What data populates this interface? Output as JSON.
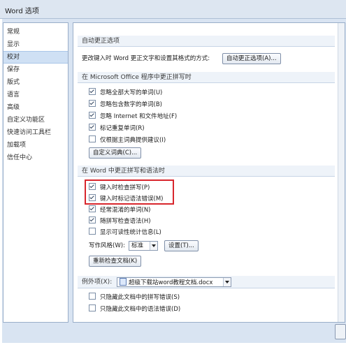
{
  "window": {
    "title": "Word 选项"
  },
  "sidebar": {
    "items": [
      {
        "label": "常规"
      },
      {
        "label": "显示"
      },
      {
        "label": "校对"
      },
      {
        "label": "保存"
      },
      {
        "label": "版式"
      },
      {
        "label": "语言"
      },
      {
        "label": "高级"
      },
      {
        "label": "自定义功能区"
      },
      {
        "label": "快速访问工具栏"
      },
      {
        "label": "加载项"
      },
      {
        "label": "信任中心"
      }
    ],
    "selected": "校对"
  },
  "autocorrect": {
    "header": "自动更正选项",
    "description": "更改键入时 Word 更正文字和设置其格式的方式:",
    "button_label": "自动更正选项(A)..."
  },
  "office_spelling": {
    "header": "在 Microsoft Office 程序中更正拼写时",
    "options": [
      {
        "label": "忽略全部大写的单词(U)",
        "checked": true
      },
      {
        "label": "忽略包含数字的单词(B)",
        "checked": true
      },
      {
        "label": "忽略 Internet 和文件地址(F)",
        "checked": true
      },
      {
        "label": "标记重复单词(R)",
        "checked": true
      },
      {
        "label": "仅根据主词典提供建议(I)",
        "checked": false
      }
    ],
    "custom_dict_button": "自定义词典(C)..."
  },
  "word_spelling": {
    "header": "在 Word 中更正拼写和语法时",
    "options": [
      {
        "label": "键入时检查拼写(P)",
        "checked": true
      },
      {
        "label": "键入时标记语法错误(M)",
        "checked": true
      },
      {
        "label": "经常混淆的单词(N)",
        "checked": true
      },
      {
        "label": "随拼写检查语法(H)",
        "checked": true
      },
      {
        "label": "显示可读性统计信息(L)",
        "checked": false
      }
    ],
    "writing_style_label": "写作风格(W):",
    "writing_style_value": "标准",
    "settings_button": "设置(T)...",
    "recheck_button": "重新检查文档(K)"
  },
  "exceptions": {
    "label": "例外项(X):",
    "document": "超级下载站word教程文档.docx",
    "options": [
      {
        "label": "只隐藏此文档中的拼写错误(S)",
        "checked": false
      },
      {
        "label": "只隐藏此文档中的语法错误(D)",
        "checked": false
      }
    ]
  }
}
